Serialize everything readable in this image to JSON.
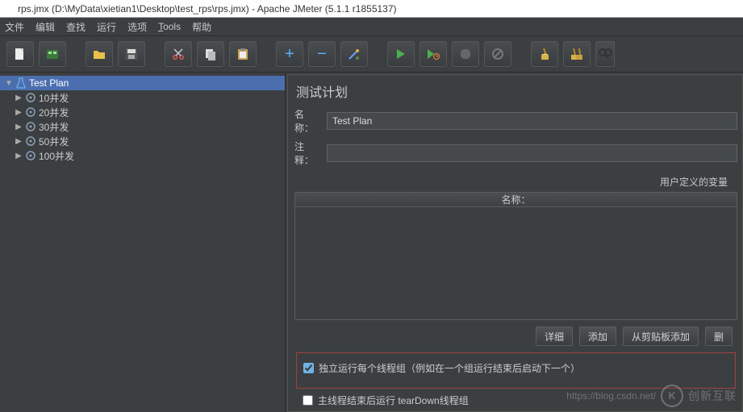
{
  "title": "rps.jmx (D:\\MyData\\xietian1\\Desktop\\test_rps\\rps.jmx) - Apache JMeter (5.1.1 r1855137)",
  "menu": {
    "file": "文件",
    "edit": "编辑",
    "search": "查找",
    "run": "运行",
    "options": "选项",
    "tools": "Tools",
    "help": "帮助"
  },
  "toolbar": {
    "new": "new",
    "templates": "templates",
    "open": "open",
    "save": "save",
    "cut": "cut",
    "copy": "copy",
    "paste": "paste",
    "add": "+",
    "remove": "−",
    "wand": "wand",
    "start": "start",
    "start_no_pause": "start-no-pause",
    "stop": "stop",
    "shutdown": "shutdown",
    "clear": "clear",
    "clear_all": "clear-all",
    "find": "find"
  },
  "tree": {
    "root": {
      "label": "Test Plan"
    },
    "items": [
      {
        "label": "10并发"
      },
      {
        "label": "20并发"
      },
      {
        "label": "30并发"
      },
      {
        "label": "50并发"
      },
      {
        "label": "100并发"
      }
    ]
  },
  "panel": {
    "title": "测试计划",
    "name_label": "名称：",
    "name_value": "Test Plan",
    "comment_label": "注释：",
    "comment_value": "",
    "vars_title": "用户定义的变量",
    "table_col_name": "名称：",
    "buttons": {
      "detail": "详细",
      "add": "添加",
      "add_clipboard": "从剪贴板添加",
      "delete": "删"
    },
    "checkbox1": "独立运行每个线程组（例如在一个组运行结束后启动下一个）",
    "checkbox2": "主线程结束后运行 tearDown线程组"
  },
  "watermark": {
    "url": "https://blog.csdn.net/",
    "brand": "创新互联"
  }
}
